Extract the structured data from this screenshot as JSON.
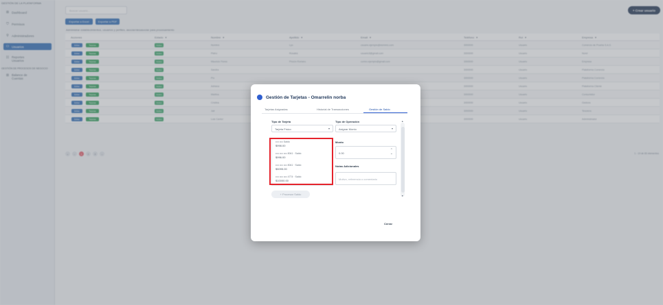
{
  "sidebar": {
    "brand": "GESTIÓN DE LA PLATAFORMA",
    "items": [
      {
        "icon": "grid-icon",
        "glyph": "⊞",
        "label": "Dashboard"
      },
      {
        "icon": "shield-icon",
        "glyph": "⛉",
        "label": "Permisos"
      },
      {
        "icon": "user-icon",
        "glyph": "⚲",
        "label": "Administradores"
      },
      {
        "icon": "users-icon",
        "glyph": "⚇",
        "label": "Usuarios"
      },
      {
        "icon": "report-icon",
        "glyph": "☷",
        "label": "Reportes",
        "label2": "Usuarios"
      }
    ],
    "section": "GESTIÓN DE PROCESOS DE NEGOCIO",
    "items2": [
      {
        "icon": "balance-icon",
        "glyph": "⊞",
        "label": "Balance de",
        "label2": "Cuentas"
      }
    ]
  },
  "toolbar": {
    "search_placeholder": "Buscar usuario...",
    "new_button": "+ Crear usuario",
    "export_excel": "Exportar a Excel",
    "export_pdf": "Exportar a PDF",
    "hint": "Administrar establecimientos, usuarios y perfiles, asociar/desasociar para procesamiento"
  },
  "table": {
    "headers": [
      "Acciones",
      "Estado",
      "Nombre",
      "Apellido",
      "Email",
      "Teléfono",
      "Rol",
      "Empresa"
    ],
    "rows": [
      {
        "btn1": "Editar",
        "btn2": "Tarjetas",
        "tag": "Activo",
        "c1": "Nombre",
        "c2": "Lyo",
        "c3": "usuario.ejemplo@dominio.com",
        "c4": "3000000",
        "c5": "Usuario",
        "c6": "Comercio de Prueba S.A.S."
      },
      {
        "btn1": "Editar",
        "btn2": "Tarjetas",
        "tag": "Activo",
        "c1": "Pietro",
        "c2": "Rosales",
        "c3": "usuario3@gmail.com",
        "c4": "3000000",
        "c5": "Usuario",
        "c6": "Norel"
      },
      {
        "btn1": "Editar",
        "btn2": "Tarjetas",
        "tag": "Activo",
        "c1": "Mauricio Flores",
        "c2": "Pinzón Romero",
        "c3": "correo.ejemplo@gmail.com",
        "c4": "3000000",
        "c5": "Usuario",
        "c6": "Empresa"
      },
      {
        "btn1": "Editar",
        "btn2": "Tarjetas",
        "tag": "Activo",
        "c1": "Sandra",
        "c2": "",
        "c3": "",
        "c4": "3000000",
        "c5": "Usuario",
        "c6": "Plataforma Comercio"
      },
      {
        "btn1": "Editar",
        "btn2": "Tarjetas",
        "tag": "Activo",
        "c1": "Pío",
        "c2": "",
        "c3": "",
        "c4": "3000000",
        "c5": "Usuario",
        "c6": "Plataforma Comercio"
      },
      {
        "btn1": "Editar",
        "btn2": "Tarjetas",
        "tag": "Activo",
        "c1": "Adriana",
        "c2": "",
        "c3": "",
        "c4": "3000000",
        "c5": "Usuario",
        "c6": "Plataforma Cliente"
      },
      {
        "btn1": "Editar",
        "btn2": "Tarjetas",
        "tag": "Activo",
        "c1": "Martina",
        "c2": "",
        "c3": "",
        "c4": "3000000",
        "c5": "Usuario",
        "c6": "Consumidor"
      },
      {
        "btn1": "Editar",
        "btn2": "Tarjetas",
        "tag": "Activo",
        "c1": "Cristina",
        "c2": "",
        "c3": "",
        "c4": "3000000",
        "c5": "Usuario",
        "c6": "Gestora"
      },
      {
        "btn1": "Editar",
        "btn2": "Tarjetas",
        "tag": "Activo",
        "c1": "Jair",
        "c2": "",
        "c3": "",
        "c4": "3000000",
        "c5": "Usuario",
        "c6": "Tesorera"
      },
      {
        "btn1": "Editar",
        "btn2": "Tarjetas",
        "tag": "Activo",
        "c1": "Luis Cantor",
        "c2": "",
        "c3": "",
        "c4": "3000000",
        "c5": "Usuario",
        "c6": "Administrador"
      }
    ],
    "pager": [
      "«",
      "‹",
      "1",
      "2",
      "3",
      "›"
    ],
    "range": "1 - 10 de 83 elementos"
  },
  "modal": {
    "title": "Gestión de Tarjetas - Omarrelin norba",
    "tabs": [
      "Tarjetas Asignadas",
      "Historial de Transacciones",
      "Gestión de Saldo"
    ],
    "card_type_label": "Tipo de Tarjeta",
    "card_type_value": "Tarjeta Físico",
    "op_type_label": "Tipo de Operación",
    "op_type_value": "Asignar Monto",
    "amount_label": "Monto",
    "amount_value": "0.00",
    "ref_label": "Notas Adicionales",
    "ref_placeholder": "Motivo, referencia o comentario",
    "dropdown": [
      {
        "line1": "•••• ••••   Saldo",
        "line2": "$998.00"
      },
      {
        "line1": "•••• •••• •••• 8041 · Saldo",
        "line2": "$996.00"
      },
      {
        "line1": "•••• •••• •••• 8041 · Saldo",
        "line2": "$5095.00"
      },
      {
        "line1": "•••• •••• •••• 4774 · Saldo",
        "line2": "$10000.00"
      }
    ],
    "add_button": "+ Procesar Saldo",
    "close_button": "Cerrar"
  },
  "colors": {
    "primary": "#2e6cb5",
    "success": "#2f9e5a",
    "navy": "#233654",
    "highlight": "#e5222b"
  }
}
